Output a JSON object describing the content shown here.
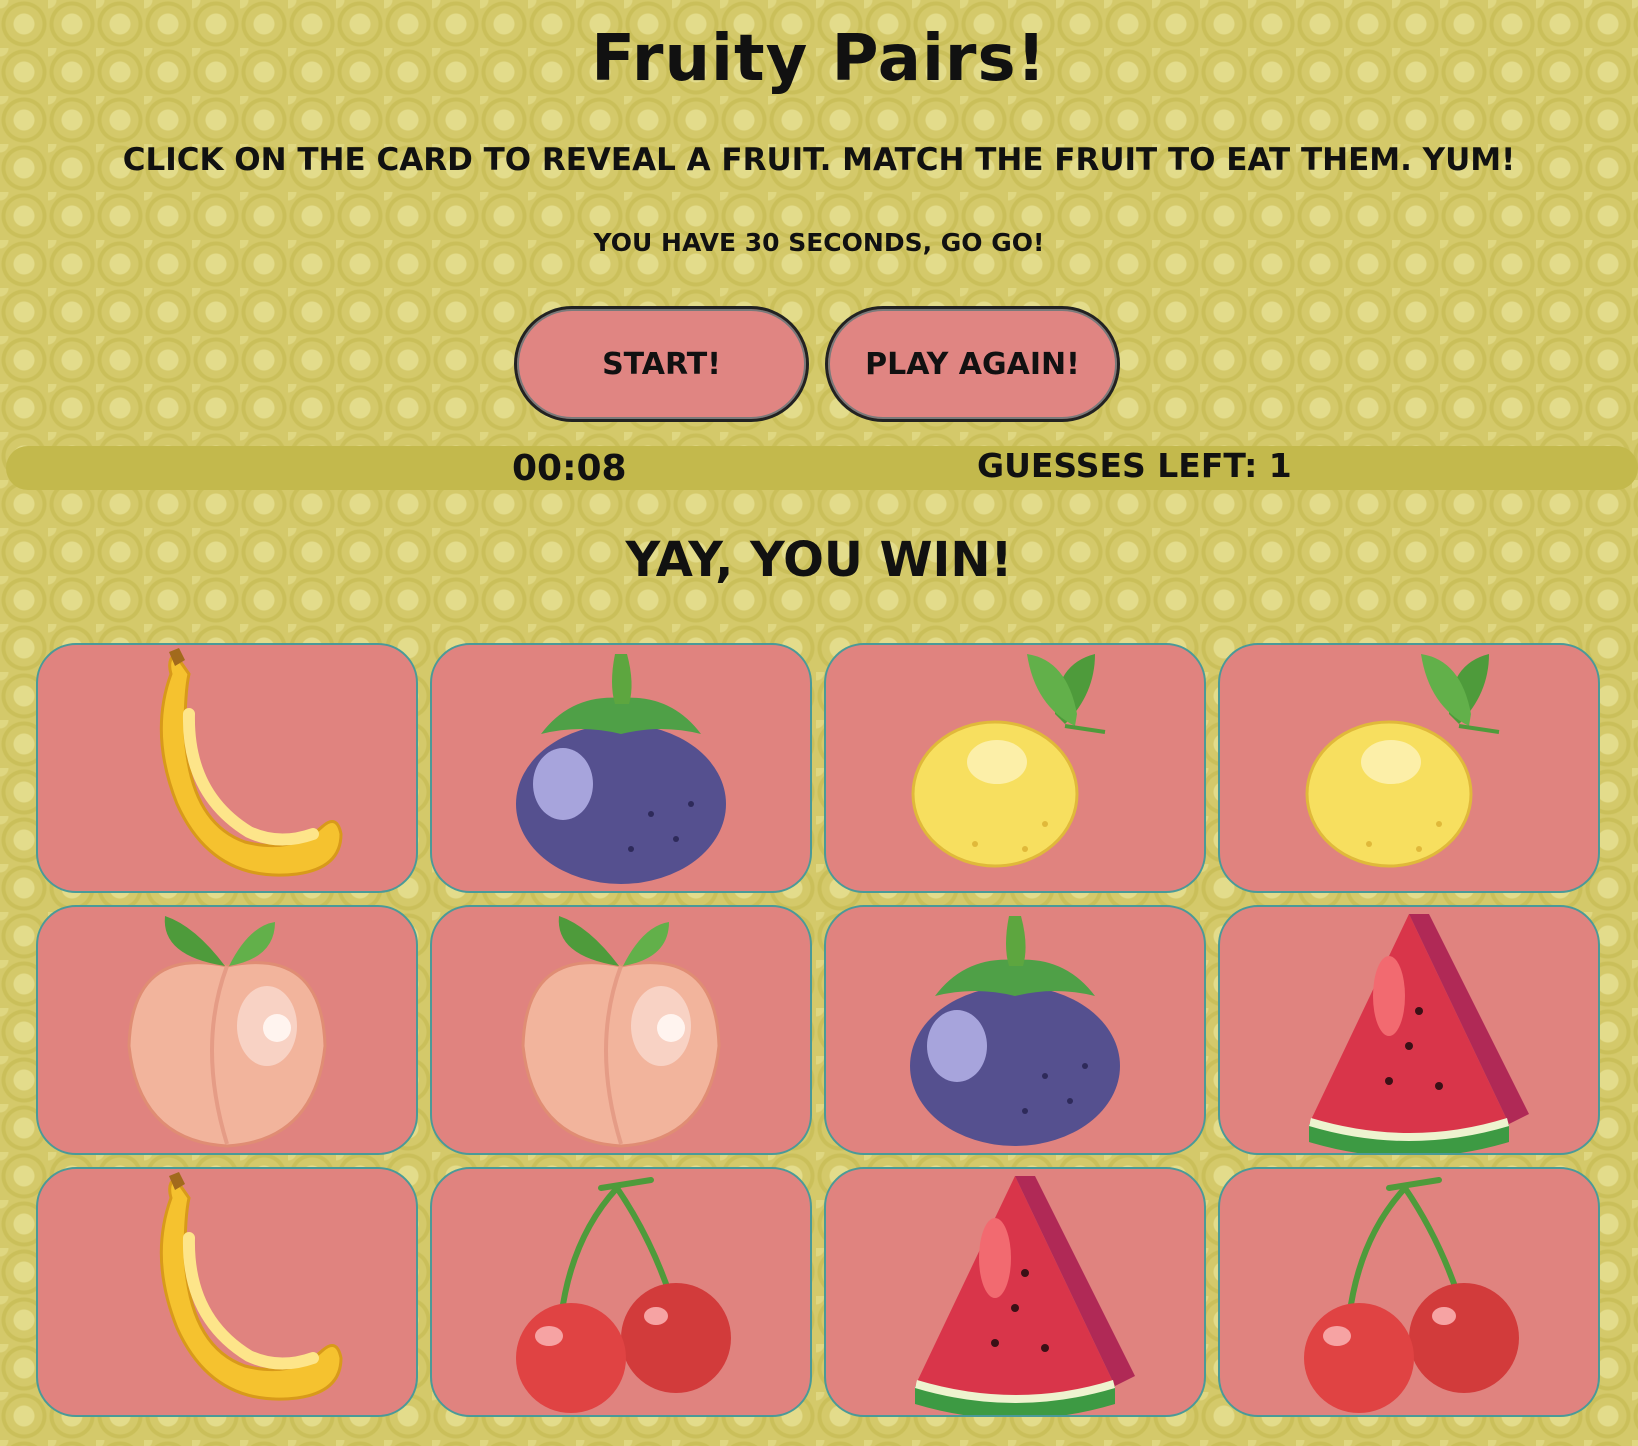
{
  "title": "Fruity Pairs!",
  "instructions": "CLICK ON THE CARD TO REVEAL A FRUIT. MATCH THE FRUIT TO EAT THEM. YUM!",
  "subtext": "YOU HAVE 30 SECONDS, GO GO!",
  "buttons": {
    "start": "START!",
    "play_again": "PLAY AGAIN!"
  },
  "status": {
    "timer": "00:08",
    "guesses": "GUESSES LEFT: 1"
  },
  "result": "YAY, YOU WIN!",
  "cards": [
    {
      "fruit": "banana"
    },
    {
      "fruit": "mangosteen"
    },
    {
      "fruit": "lemon"
    },
    {
      "fruit": "lemon"
    },
    {
      "fruit": "peach"
    },
    {
      "fruit": "peach"
    },
    {
      "fruit": "mangosteen"
    },
    {
      "fruit": "watermelon"
    },
    {
      "fruit": "banana"
    },
    {
      "fruit": "cherry"
    },
    {
      "fruit": "watermelon"
    },
    {
      "fruit": "cherry"
    }
  ],
  "colors": {
    "background": "#d4c96a",
    "button": "#e08582",
    "card": "#e0837f",
    "card_border": "#4a9a98",
    "status_bar": "#c3b94c"
  }
}
